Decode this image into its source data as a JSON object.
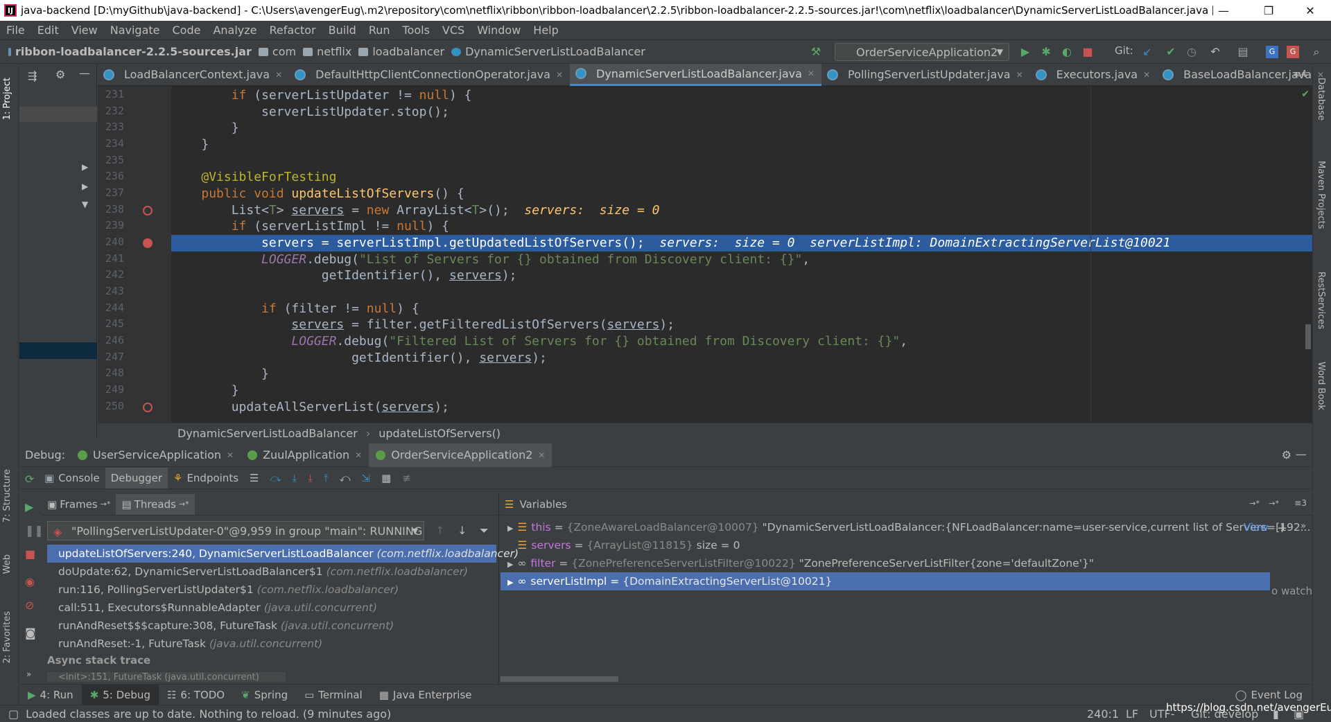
{
  "window": {
    "title": "java-backend [D:\\myGithub\\java-backend] - C:\\Users\\avengerEug\\.m2\\repository\\com\\netflix\\ribbon\\ribbon-loadbalancer\\2.2.5\\ribbon-loadbalancer-2.2.5-sources.jar!\\com\\netflix\\loadbalancer\\DynamicServerListLoadBalancer.java [Ma...",
    "minimize": "—",
    "restore": "❐",
    "close": "✕"
  },
  "menu": [
    "File",
    "Edit",
    "View",
    "Navigate",
    "Code",
    "Analyze",
    "Refactor",
    "Build",
    "Run",
    "Tools",
    "VCS",
    "Window",
    "Help"
  ],
  "nav": {
    "breadcrumbs": [
      "ribbon-loadbalancer-2.2.5-sources.jar",
      "com",
      "netflix",
      "loadbalancer",
      "DynamicServerListLoadBalancer"
    ],
    "run_config": "OrderServiceApplication2",
    "git_label": "Git:"
  },
  "left_stripe": [
    "1: Project",
    "7: Structure",
    "Web",
    "2: Favorites"
  ],
  "right_stripe": [
    "Database",
    "Maven Projects",
    "RestServices",
    "Word Book"
  ],
  "editor_tabs": [
    {
      "label": "LoadBalancerContext.java",
      "active": false
    },
    {
      "label": "DefaultHttpClientConnectionOperator.java",
      "active": false
    },
    {
      "label": "DynamicServerListLoadBalancer.java",
      "active": true
    },
    {
      "label": "PollingServerListUpdater.java",
      "active": false
    },
    {
      "label": "Executors.java",
      "active": false
    },
    {
      "label": "BaseLoadBalancer.java",
      "active": false
    }
  ],
  "tabs_overflow": "≡4",
  "line_numbers": [
    "231",
    "232",
    "233",
    "234",
    "235",
    "236",
    "237",
    "238",
    "239",
    "240",
    "241",
    "242",
    "243",
    "244",
    "245",
    "246",
    "247",
    "248",
    "249",
    "250"
  ],
  "code": {
    "l231_a": "if",
    "l231_b": " (serverListUpdater != ",
    "l231_c": "null",
    "l231_d": ") {",
    "l232": "serverListUpdater.stop();",
    "l233": "}",
    "l234": "}",
    "l236": "@VisibleForTesting",
    "l237_a": "public void ",
    "l237_b": "updateListOfServers",
    "l237_c": "() {",
    "l238_a": "List<",
    "l238_b": "T",
    "l238_c": "> ",
    "l238_d": "servers",
    "l238_e": " = ",
    "l238_f": "new ",
    "l238_g": "ArrayList<",
    "l238_h": "T",
    "l238_i": ">();",
    "l238_inline": "servers:  size = 0",
    "l239_a": "if",
    "l239_b": " (serverListImpl != ",
    "l239_c": "null",
    "l239_d": ") {",
    "l240_code": "servers = serverListImpl.getUpdatedListOfServers();",
    "l240_inline": "servers:  size = 0  serverListImpl: DomainExtractingServerList@10021",
    "l241_a": "LOGGER",
    "l241_b": ".debug(",
    "l241_c": "\"List of Servers for {} obtained from Discovery client: {}\"",
    "l241_d": ",",
    "l242_a": "getIdentifier(), ",
    "l242_b": "servers",
    "l242_c": ");",
    "l244_a": "if",
    "l244_b": " (filter != ",
    "l244_c": "null",
    "l244_d": ") {",
    "l245_a": "servers",
    "l245_b": " = filter.getFilteredListOfServers(",
    "l245_c": "servers",
    "l245_d": ");",
    "l246_a": "LOGGER",
    "l246_b": ".debug(",
    "l246_c": "\"Filtered List of Servers for {} obtained from Discovery client: {}\"",
    "l246_d": ",",
    "l247_a": "getIdentifier(), ",
    "l247_b": "servers",
    "l247_c": ");",
    "l248": "}",
    "l249": "}",
    "l250_a": "updateAllServerList(",
    "l250_b": "servers",
    "l250_c": ");"
  },
  "editor_breadcrumb": [
    "DynamicServerListLoadBalancer",
    "updateListOfServers()"
  ],
  "debug": {
    "label": "Debug:",
    "sessions": [
      "UserServiceApplication",
      "ZuulApplication",
      "OrderServiceApplication2"
    ],
    "toolbar": {
      "console": "Console",
      "debugger": "Debugger",
      "endpoints": "Endpoints"
    },
    "frames_tab": "Frames",
    "threads_tab": "Threads",
    "thread_select": "\"PollingServerListUpdater-0\"@9,959 in group \"main\": RUNNING",
    "frames": [
      {
        "method": "updateListOfServers:240, DynamicServerListLoadBalancer",
        "pkg": "(com.netflix.loadbalancer)"
      },
      {
        "method": "doUpdate:62, DynamicServerListLoadBalancer$1",
        "pkg": "(com.netflix.loadbalancer)"
      },
      {
        "method": "run:116, PollingServerListUpdater$1",
        "pkg": "(com.netflix.loadbalancer)"
      },
      {
        "method": "call:511, Executors$RunnableAdapter",
        "pkg": "(java.util.concurrent)"
      },
      {
        "method": "runAndReset$$$capture:308, FutureTask",
        "pkg": "(java.util.concurrent)"
      },
      {
        "method": "runAndReset:-1, FutureTask",
        "pkg": "(java.util.concurrent)"
      }
    ],
    "async_label": "Async stack trace",
    "async_frame": "<init>:151, FutureTask (java.util.concurrent)",
    "variables_title": "Variables",
    "variables": [
      {
        "name": "this",
        "eq": " = ",
        "type": "{ZoneAwareLoadBalancer@10007}",
        "value": " \"DynamicServerListLoadBalancer:{NFLoadBalancer:name=user-service,current list of Servers=[192..."
      },
      {
        "name": "servers",
        "eq": " = ",
        "type": "{ArrayList@11815}",
        "value": "  size = 0"
      },
      {
        "name": "filter",
        "eq": " = ",
        "type": "{ZonePreferenceServerListFilter@10022}",
        "value": " \"ZonePreferenceServerListFilter{zone='defaultZone'}\""
      },
      {
        "name": "serverListImpl",
        "eq": " = ",
        "type": "{DomainExtractingServerList@10021}",
        "value": ""
      }
    ],
    "view_link": "View",
    "watches_text": "o watche"
  },
  "bottom_tabs": [
    "4: Run",
    "5: Debug",
    "6: TODO",
    "Spring",
    "Terminal",
    "Java Enterprise"
  ],
  "event_log": "Event Log",
  "status": {
    "message": "Loaded classes are up to date. Nothing to reload. (9 minutes ago)",
    "position": "240:1",
    "line_sep": "LF",
    "encoding": "UTF-",
    "watermark": "https://blog.csdn.net/avengerEug",
    "git_branch": "Git: develop"
  },
  "colors": {
    "accent": "#4b6eaf",
    "exec_line": "#2d5c9e",
    "breakpoint": "#c75450",
    "run_green": "#59a869"
  }
}
